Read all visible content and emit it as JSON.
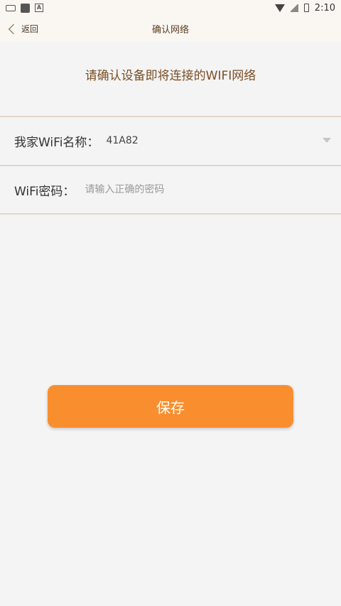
{
  "status_bar": {
    "time": "2:10"
  },
  "nav": {
    "back_label": "返回",
    "title": "确认网络"
  },
  "prompt": "请确认设备即将连接的WIFI网络",
  "wifi_name": {
    "label": "我家WiFi名称：",
    "value": "41A82"
  },
  "wifi_password": {
    "label": "WiFi密码：",
    "placeholder": "请输入正确的密码",
    "value": ""
  },
  "save_button": {
    "label": "保存"
  },
  "colors": {
    "accent": "#f98e2f",
    "title_brown": "#7a4e26",
    "background": "#f4f4f4"
  }
}
